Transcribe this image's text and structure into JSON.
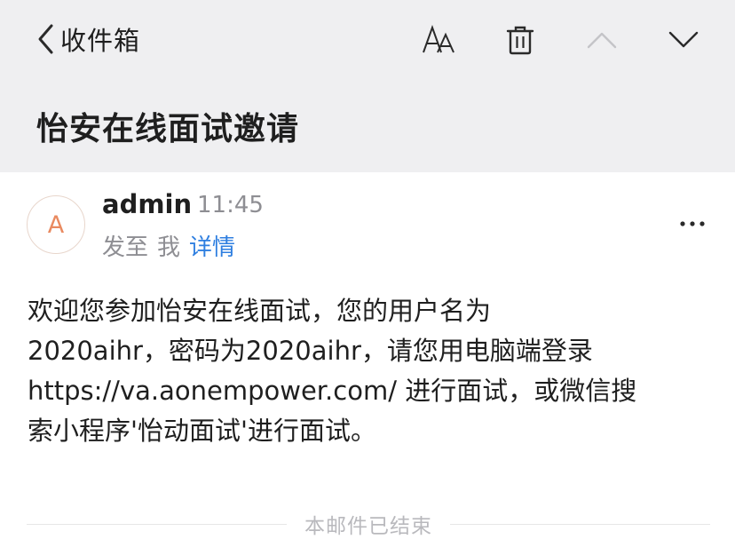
{
  "nav": {
    "back_label": "收件箱"
  },
  "toolbar": {
    "icons": [
      "font-size-icon",
      "trash-icon",
      "chevron-up-icon",
      "chevron-down-icon"
    ]
  },
  "email": {
    "subject": "怡安在线面试邀请",
    "sender": {
      "avatar_letter": "A",
      "name": "admin",
      "time": "11:45"
    },
    "recipient_prefix": "发至",
    "recipient": "我",
    "details_link": "详情",
    "body_lines": [
      "欢迎您参加怡安在线面试，您的用户名为",
      "2020aihr，密码为2020aihr，请您用电脑端登录",
      "https://va.aonempower.com/ 进行面试，或微信搜",
      "索小程序'怡动面试'进行面试。"
    ],
    "end_label": "本邮件已结束"
  },
  "colors": {
    "header_bg": "#efeff1",
    "link": "#2f7fe0",
    "avatar_letter": "#e98a60",
    "muted_text": "#8e8e93"
  }
}
